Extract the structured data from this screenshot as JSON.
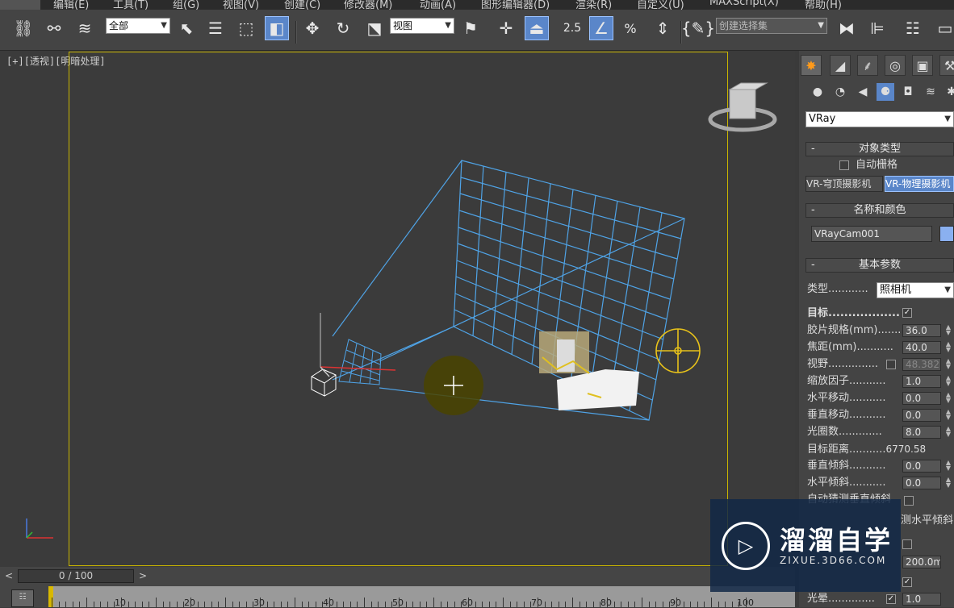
{
  "menu": [
    "编辑(E)",
    "工具(T)",
    "组(G)",
    "视图(V)",
    "创建(C)",
    "修改器(M)",
    "动画(A)",
    "图形编辑器(D)",
    "渲染(R)",
    "自定义(U)",
    "MAXScript(X)",
    "帮助(H)"
  ],
  "toolbar": {
    "selection_filter": "全部",
    "ref_coord": "视图",
    "snap_value": "2.5",
    "named_selection": "创建选择集"
  },
  "viewport": {
    "label_plus": "[+]",
    "label_view": "[透视]",
    "label_shading": "[明暗处理]"
  },
  "panel": {
    "renderer_dropdown": "VRay",
    "object_type": {
      "title": "对象类型",
      "autogrid": "自动栅格",
      "btn_dome": "VR-穹顶摄影机",
      "btn_physical": "VR-物理摄影机"
    },
    "name_color": {
      "title": "名称和颜色",
      "name": "VRayCam001",
      "color": "#8ab0f0"
    },
    "basic_params": {
      "title": "基本参数",
      "type_label": "类型............",
      "type_value": "照相机",
      "rows": [
        {
          "label": "目标..................",
          "kind": "check",
          "checked": true
        },
        {
          "label": "胶片规格(mm).......",
          "kind": "spin",
          "value": "36.0"
        },
        {
          "label": "焦距(mm)...........",
          "kind": "spin",
          "value": "40.0"
        },
        {
          "label": "视野...............",
          "kind": "checkspin",
          "checked": false,
          "value": "48.382"
        },
        {
          "label": "缩放因子...........",
          "kind": "spin",
          "value": "1.0"
        },
        {
          "label": "水平移动...........",
          "kind": "spin",
          "value": "0.0"
        },
        {
          "label": "垂直移动...........",
          "kind": "spin",
          "value": "0.0"
        },
        {
          "label": "光圈数.............",
          "kind": "spin",
          "value": "8.0"
        },
        {
          "label": "目标距离...........",
          "kind": "text",
          "value": "6770.58"
        },
        {
          "label": "垂直倾斜...........",
          "kind": "spin",
          "value": "0.0"
        },
        {
          "label": "水平倾斜...........",
          "kind": "spin",
          "value": "0.0"
        },
        {
          "label": "自动猜测垂直倾斜",
          "kind": "check",
          "checked": false
        }
      ],
      "guess_horizontal": "测水平倾斜",
      "hidden_value": "200.0m",
      "vignette_label": "光晕..............",
      "vignette_value": "1.0"
    }
  },
  "timeline": {
    "frame_display": "0 / 100",
    "ticks": [
      "10",
      "20",
      "30",
      "40",
      "50",
      "60",
      "70",
      "80",
      "90",
      "100"
    ]
  },
  "watermark": {
    "title": "溜溜自学",
    "subtitle": "ZIXUE.3D66.COM"
  }
}
